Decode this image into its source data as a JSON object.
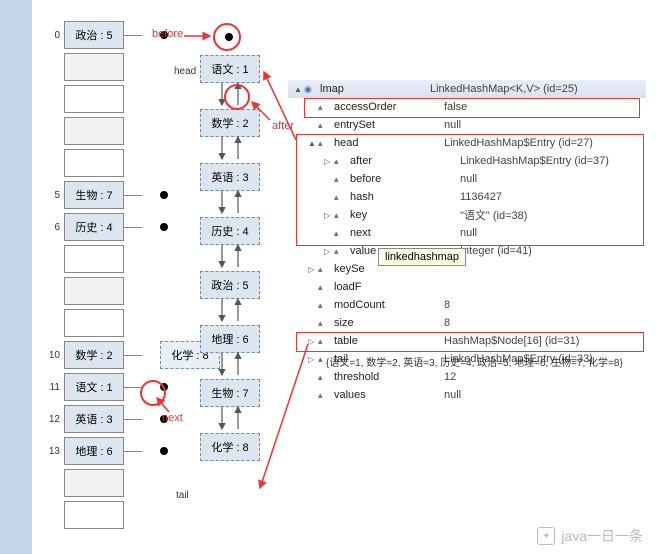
{
  "hashTable": {
    "rows": [
      {
        "idx": "0",
        "label": "政治 : 5",
        "filled": true,
        "dot": true
      },
      {
        "idx": "",
        "label": "",
        "filled": false,
        "alt": true
      },
      {
        "idx": "",
        "label": "",
        "filled": false
      },
      {
        "idx": "",
        "label": "",
        "filled": false,
        "alt": true
      },
      {
        "idx": "",
        "label": "",
        "filled": false
      },
      {
        "idx": "5",
        "label": "生物 : 7",
        "filled": true,
        "dot": true
      },
      {
        "idx": "6",
        "label": "历史 : 4",
        "filled": true,
        "dot": true
      },
      {
        "idx": "",
        "label": "",
        "filled": false
      },
      {
        "idx": "",
        "label": "",
        "filled": false,
        "alt": true
      },
      {
        "idx": "",
        "label": "",
        "filled": false
      },
      {
        "idx": "10",
        "label": "数学 : 2",
        "filled": true,
        "dot": true,
        "extra": "化学 : 8"
      },
      {
        "idx": "11",
        "label": "语文 : 1",
        "filled": true,
        "dot": true
      },
      {
        "idx": "12",
        "label": "英语 : 3",
        "filled": true,
        "dot": true
      },
      {
        "idx": "13",
        "label": "地理 : 6",
        "filled": true,
        "dot": true
      },
      {
        "idx": "",
        "label": "",
        "filled": false,
        "alt": true
      },
      {
        "idx": "",
        "label": "",
        "filled": false
      }
    ]
  },
  "linkedList": {
    "headLabel": "head",
    "tailLabel": "tail",
    "nodes": [
      "语文 : 1",
      "数学 : 2",
      "英语 : 3",
      "历史 : 4",
      "政治 : 5",
      "地理 : 6",
      "生物 : 7",
      "化学 : 8"
    ]
  },
  "labels": {
    "before": "before",
    "after": "after",
    "next": "next"
  },
  "tooltip": "linkedhashmap",
  "codeLine": "{语文=1, 数学=2, 英语=3, 历史=4, 政治=5, 地理=6, 生物=7, 化学=8}",
  "debug": {
    "root": {
      "name": "lmap",
      "value": "LinkedHashMap<K,V>  (id=25)"
    },
    "rows": [
      {
        "ind": 1,
        "tri": "",
        "name": "accessOrder",
        "value": "false"
      },
      {
        "ind": 1,
        "tri": "",
        "name": "entrySet",
        "value": "null"
      },
      {
        "ind": 1,
        "tri": "▲",
        "name": "head",
        "value": "LinkedHashMap$Entry<K,V>  (id=27)"
      },
      {
        "ind": 2,
        "tri": "▷",
        "name": "after",
        "value": "LinkedHashMap$Entry<K,V>  (id=37)"
      },
      {
        "ind": 2,
        "tri": "",
        "name": "before",
        "value": "null"
      },
      {
        "ind": 2,
        "tri": "",
        "name": "hash",
        "value": "1136427"
      },
      {
        "ind": 2,
        "tri": "▷",
        "name": "key",
        "value": "\"语文\" (id=38)"
      },
      {
        "ind": 2,
        "tri": "",
        "name": "next",
        "value": "null"
      },
      {
        "ind": 2,
        "tri": "▷",
        "name": "value",
        "value": "Integer  (id=41)"
      },
      {
        "ind": 1,
        "tri": "▷",
        "name": "keySe",
        "value": ""
      },
      {
        "ind": 1,
        "tri": "",
        "name": "loadF",
        "value": ""
      },
      {
        "ind": 1,
        "tri": "",
        "name": "modCount",
        "value": "8"
      },
      {
        "ind": 1,
        "tri": "",
        "name": "size",
        "value": "8"
      },
      {
        "ind": 1,
        "tri": "▷",
        "name": "table",
        "value": "HashMap$Node<K,V>[16]  (id=31)"
      },
      {
        "ind": 1,
        "tri": "▷",
        "name": "tail",
        "value": "LinkedHashMap$Entry<K,V>  (id=33)"
      },
      {
        "ind": 1,
        "tri": "",
        "name": "threshold",
        "value": "12"
      },
      {
        "ind": 1,
        "tri": "",
        "name": "values",
        "value": "null"
      }
    ]
  },
  "watermark": "java一日一条"
}
